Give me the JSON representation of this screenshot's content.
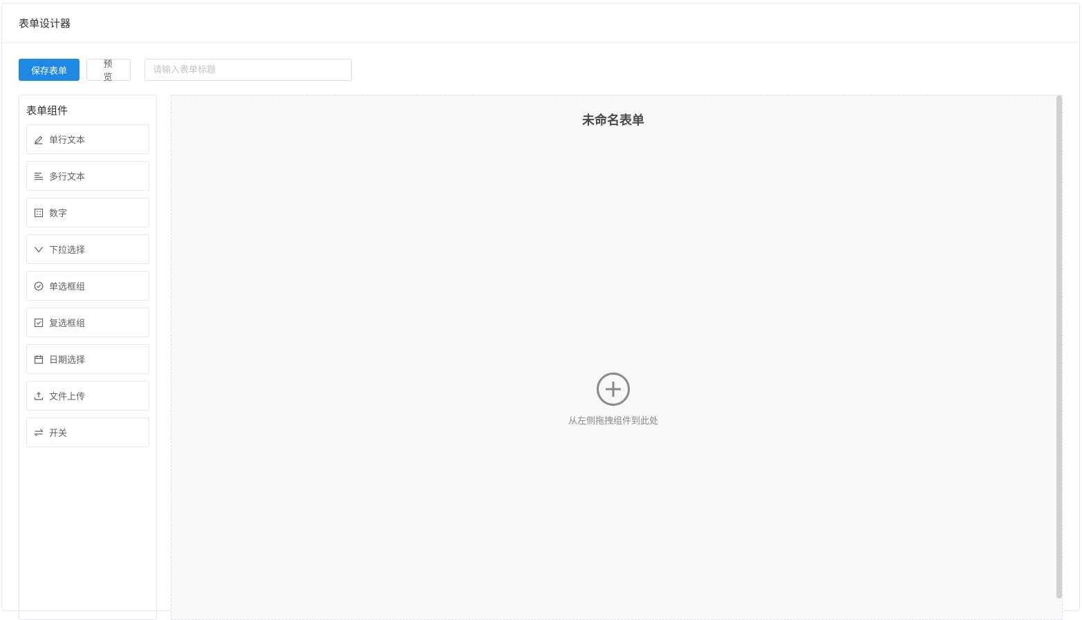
{
  "app": {
    "title": "表单设计器"
  },
  "toolbar": {
    "save_label": "保存表单",
    "preview_label": "预 览",
    "title_placeholder": "请输入表单标题",
    "title_value": ""
  },
  "palette": {
    "title": "表单组件",
    "items": [
      {
        "label": "单行文本",
        "icon": "pencil-icon"
      },
      {
        "label": "多行文本",
        "icon": "paragraph-icon"
      },
      {
        "label": "数字",
        "icon": "calculator-icon"
      },
      {
        "label": "下拉选择",
        "icon": "chevron-down-icon"
      },
      {
        "label": "单选框组",
        "icon": "circle-check-icon"
      },
      {
        "label": "复选框组",
        "icon": "checkbox-icon"
      },
      {
        "label": "日期选择",
        "icon": "calendar-icon"
      },
      {
        "label": "文件上传",
        "icon": "upload-icon"
      },
      {
        "label": "开关",
        "icon": "switch-icon"
      }
    ]
  },
  "canvas": {
    "form_title": "未命名表单",
    "empty_hint": "从左侧拖拽组件到此处"
  },
  "colors": {
    "primary": "#1e88e5",
    "canvas_bg": "#f8f8f8"
  }
}
